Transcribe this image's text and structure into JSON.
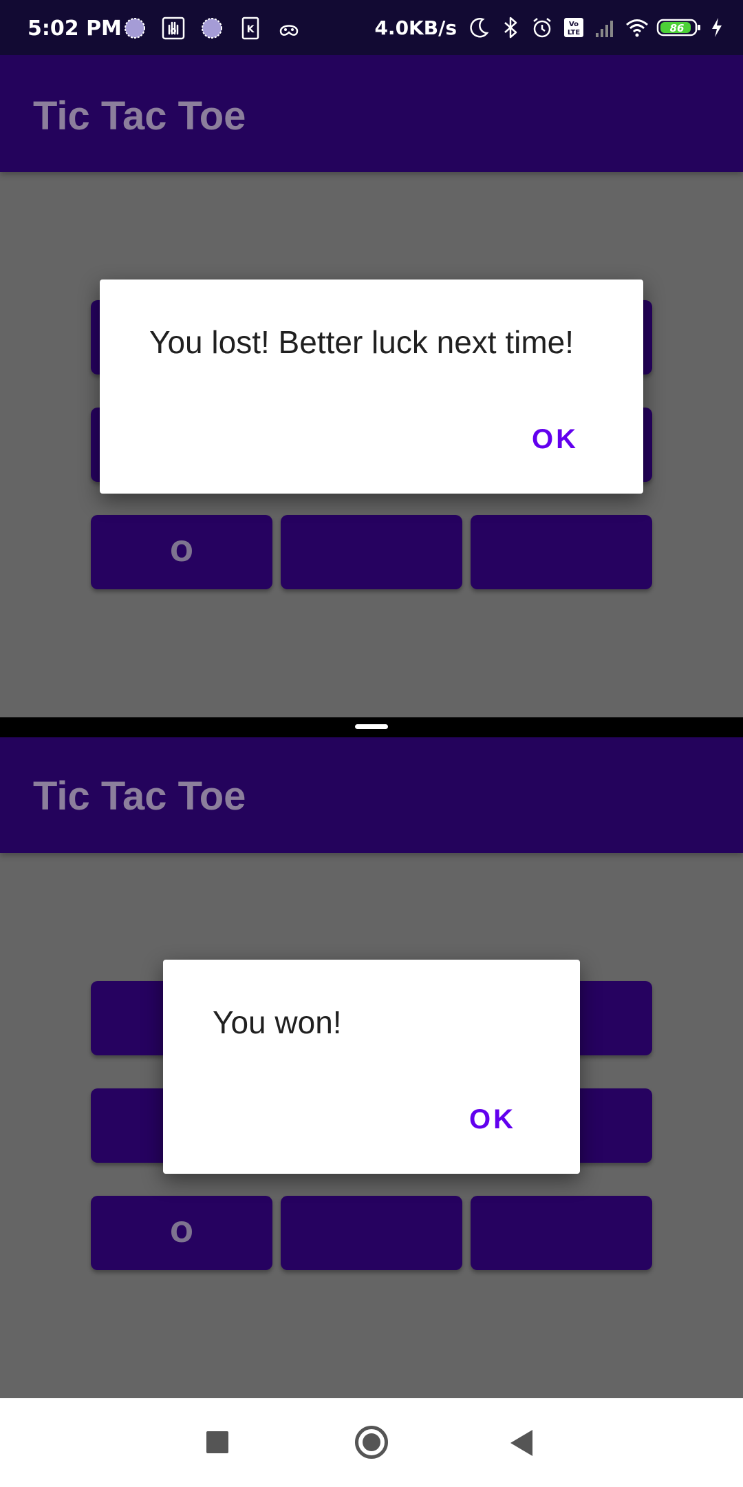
{
  "status_bar": {
    "time": "5:02 PM",
    "net_speed": "4.0KB/s",
    "battery_level": "86",
    "left_icons": [
      "loading-circle-icon",
      "hand-icon",
      "loading-circle-icon",
      "k-app-icon",
      "game-controller-icon"
    ],
    "right_icons": [
      "moon-icon",
      "bluetooth-icon",
      "alarm-icon",
      "volte-icon",
      "signal-icon",
      "wifi-icon",
      "battery-icon",
      "charging-icon"
    ],
    "colors": {
      "background": "#120a33"
    }
  },
  "top_panel": {
    "app_title": "Tic Tac Toe",
    "board": [
      "",
      "",
      "",
      "",
      "",
      "",
      "O",
      "",
      ""
    ],
    "dialog": {
      "message": "You lost! Better luck next time!",
      "ok_label": "OK"
    }
  },
  "bottom_panel": {
    "app_title": "Tic Tac Toe",
    "board": [
      "",
      "",
      "",
      "",
      "",
      "",
      "O",
      "",
      ""
    ],
    "dialog": {
      "message": "You won!",
      "ok_label": "OK"
    }
  },
  "colors": {
    "app_bar": "#24035c",
    "cell": "#260260",
    "scrim_background": "#656565",
    "dialog_accent": "#6200ee"
  },
  "nav_bar": {
    "icons": [
      "recents-icon",
      "home-icon",
      "back-icon"
    ]
  }
}
